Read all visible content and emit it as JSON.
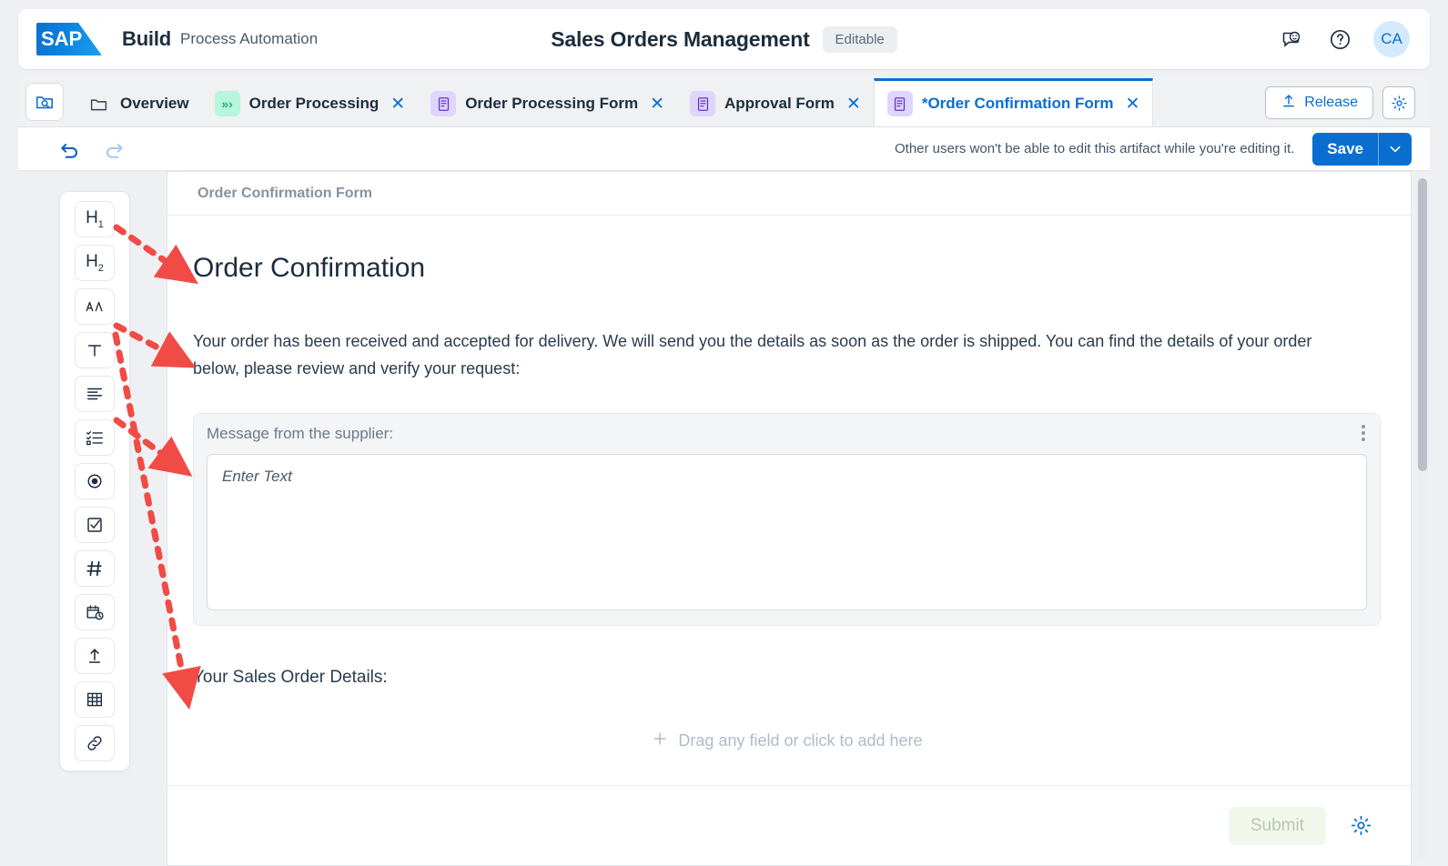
{
  "header": {
    "logo_text": "SAP",
    "brand": "Build",
    "brand_sub": "Process Automation",
    "title": "Sales Orders Management",
    "status_badge": "Editable",
    "feedback_icon": "feedback-smiley-icon",
    "help_icon": "help-question-icon",
    "avatar_initials": "CA"
  },
  "tabbar": {
    "home_icon": "folder-search-icon",
    "tabs": [
      {
        "label": "Overview",
        "icon": "folder-icon",
        "icon_kind": "none",
        "closable": false,
        "active": false
      },
      {
        "label": "Order Processing",
        "icon": "process-chevrons-icon",
        "icon_kind": "process",
        "closable": true,
        "active": false
      },
      {
        "label": "Order Processing Form",
        "icon": "form-icon",
        "icon_kind": "form",
        "closable": true,
        "active": false
      },
      {
        "label": "Approval Form",
        "icon": "form-icon",
        "icon_kind": "form",
        "closable": true,
        "active": false
      },
      {
        "label": "*Order Confirmation Form",
        "icon": "form-icon",
        "icon_kind": "form",
        "closable": true,
        "active": true
      }
    ],
    "release_label": "Release",
    "release_icon": "upload-arrow-icon",
    "settings_icon": "gear-icon"
  },
  "actionbar": {
    "undo_icon": "undo-arrow-icon",
    "redo_icon": "redo-arrow-icon",
    "edit_note": "Other users won't be able to edit this artifact while you're editing it.",
    "save_label": "Save",
    "save_caret_icon": "chevron-down-icon"
  },
  "palette": {
    "items": [
      {
        "name": "heading-1",
        "glyph": "H₁"
      },
      {
        "name": "heading-2",
        "glyph": "H₂"
      },
      {
        "name": "rich-text",
        "glyph": "AA"
      },
      {
        "name": "text-field",
        "glyph": "T"
      },
      {
        "name": "paragraph",
        "glyph": "paragraph-lines"
      },
      {
        "name": "checklist",
        "glyph": "checklist"
      },
      {
        "name": "radio-button",
        "glyph": "radio"
      },
      {
        "name": "checkbox",
        "glyph": "checkbox"
      },
      {
        "name": "number-field",
        "glyph": "#"
      },
      {
        "name": "date-time",
        "glyph": "calendar-clock"
      },
      {
        "name": "file-upload",
        "glyph": "upload"
      },
      {
        "name": "table",
        "glyph": "grid"
      },
      {
        "name": "link",
        "glyph": "link"
      }
    ]
  },
  "canvas": {
    "breadcrumb": "Order Confirmation Form",
    "heading": "Order Confirmation",
    "paragraph": "Your order has been received and accepted for delivery. We will send you the details as soon as the order is shipped. You can find the details of your order below, please review and verify your request:",
    "field": {
      "label": "Message from the supplier:",
      "placeholder": "Enter Text",
      "value": "",
      "menu_icon": "kebab-menu-icon"
    },
    "subheading": "Your Sales Order Details:",
    "dropzone_text": "Drag any field or click to add here",
    "dropzone_icon": "plus-icon",
    "submit_label": "Submit",
    "footer_settings_icon": "gear-icon"
  },
  "colors": {
    "accent": "#0a6ed1",
    "annotation": "#f04b45",
    "process_tab": "#b8f5dd",
    "form_tab": "#dfd5fd",
    "avatar_bg": "#d3eafd"
  }
}
